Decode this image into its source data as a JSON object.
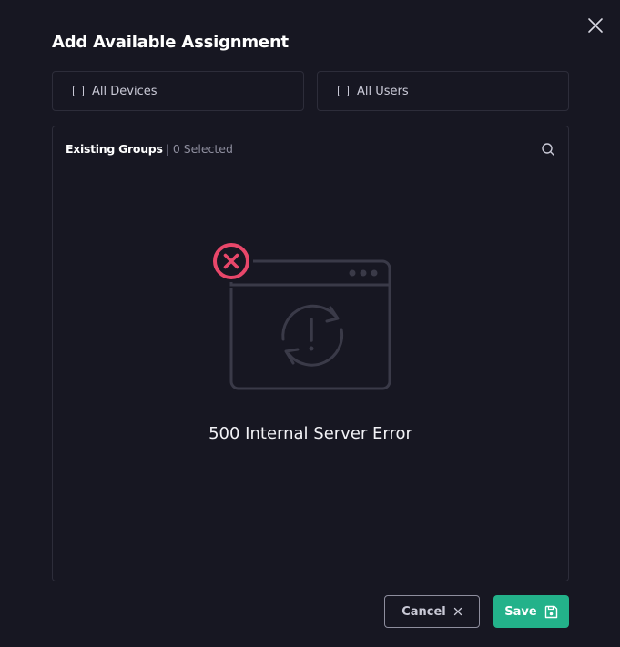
{
  "dialog": {
    "title": "Add Available Assignment"
  },
  "options": {
    "all_devices": {
      "label": "All Devices",
      "checked": false
    },
    "all_users": {
      "label": "All Users",
      "checked": false
    }
  },
  "groups": {
    "heading": "Existing Groups",
    "separator": "|",
    "selected_count": "0 Selected"
  },
  "error": {
    "message": "500 Internal Server Error"
  },
  "footer": {
    "cancel_label": "Cancel",
    "save_label": "Save"
  },
  "colors": {
    "background": "#171722",
    "border": "#2d2d3a",
    "error_accent": "#e8476a",
    "save_button": "#23b28a"
  },
  "icons": {
    "close": "close-icon",
    "search": "search-icon",
    "error": "error-x-icon",
    "cancel": "close-small-icon",
    "save": "floppy-disk-icon"
  }
}
